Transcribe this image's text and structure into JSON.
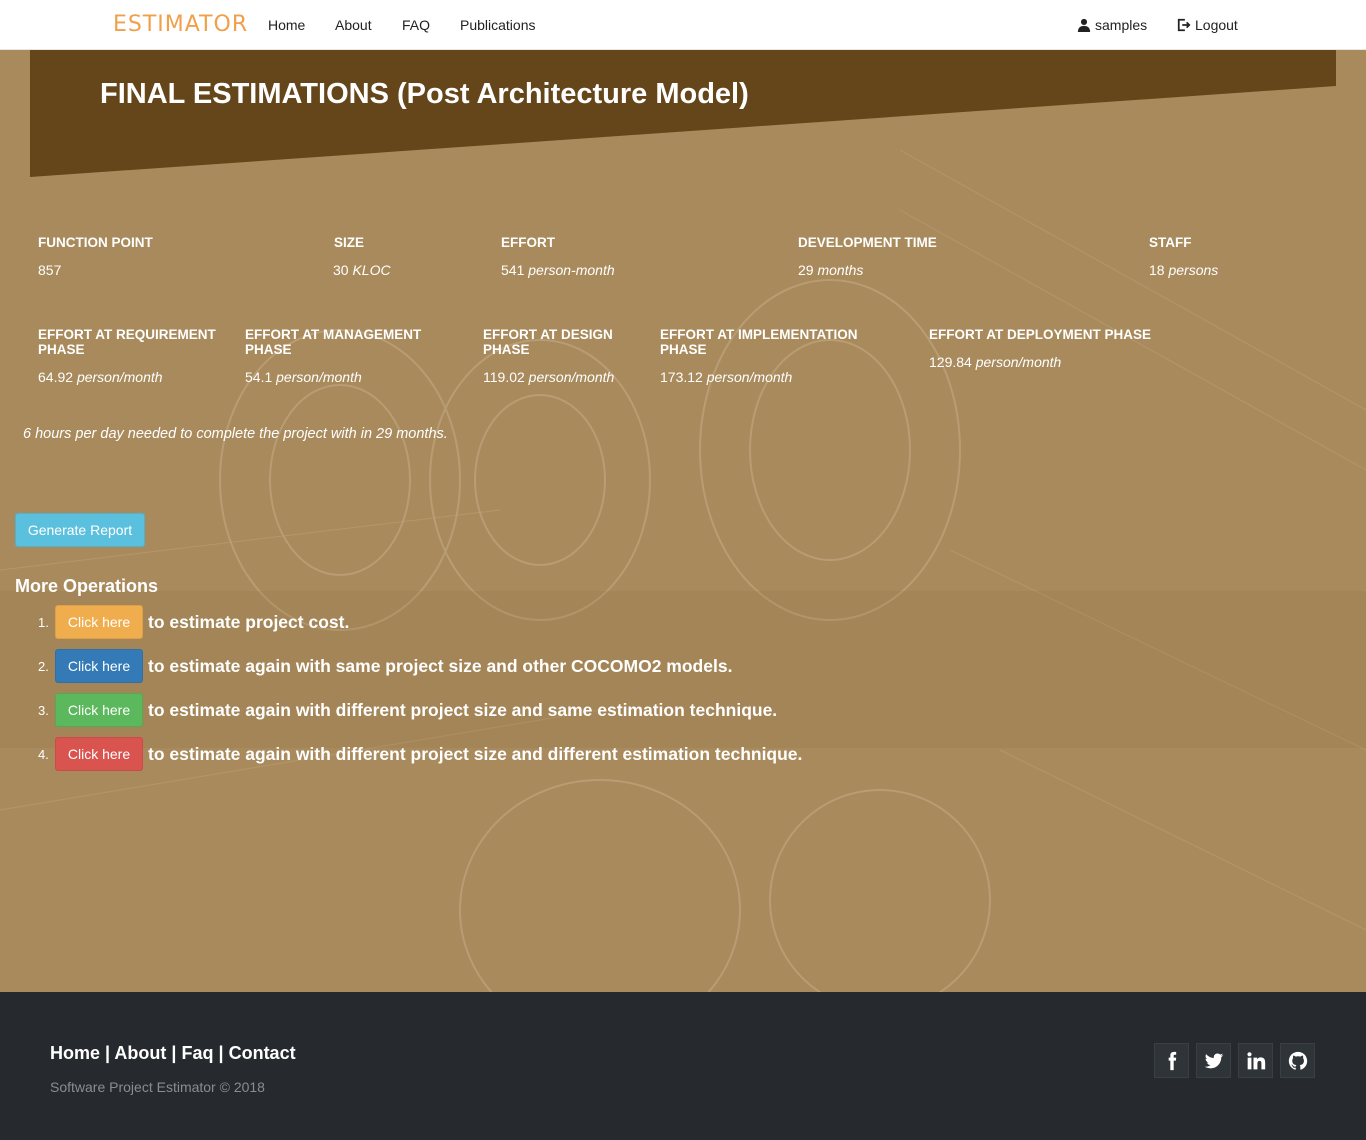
{
  "nav": {
    "logo": "ESTIMATOR",
    "links": [
      "Home",
      "About",
      "FAQ",
      "Publications"
    ],
    "user": "samples",
    "logout": "Logout"
  },
  "banner": {
    "title": "FINAL ESTIMATIONS (Post Architecture Model)"
  },
  "stats_row1": [
    {
      "label": "FUNCTION POINT",
      "value": "857",
      "unit": ""
    },
    {
      "label": "SIZE",
      "value": "30",
      "unit": "KLOC"
    },
    {
      "label": "EFFORT",
      "value": "541",
      "unit": "person-month"
    },
    {
      "label": "DEVELOPMENT TIME",
      "value": "29",
      "unit": "months"
    },
    {
      "label": "STAFF",
      "value": "18",
      "unit": "persons"
    }
  ],
  "stats_row2": [
    {
      "label_line1": "EFFORT AT REQUIREMENT",
      "label_line2": "PHASE",
      "value": "64.92",
      "unit": "person/month"
    },
    {
      "label_line1": "EFFORT AT MANAGEMENT",
      "label_line2": "PHASE",
      "value": "54.1",
      "unit": "person/month"
    },
    {
      "label_line1": "EFFORT AT DESIGN",
      "label_line2": "PHASE",
      "value": "119.02",
      "unit": "person/month"
    },
    {
      "label_line1": "EFFORT AT IMPLEMENTATION",
      "label_line2": "PHASE",
      "value": "173.12",
      "unit": "person/month"
    },
    {
      "label_line1": "EFFORT AT DEPLOYMENT PHASE",
      "label_line2": "",
      "value": "129.84",
      "unit": "person/month"
    }
  ],
  "note": "6 hours per day needed to complete the project with in 29 months.",
  "generate_report": "Generate Report",
  "more_operations": {
    "title": "More Operations",
    "items": [
      {
        "num": "1.",
        "button": "Click here",
        "text": "to estimate project cost."
      },
      {
        "num": "2.",
        "button": "Click here",
        "text": "to estimate again with same project size and other COCOMO2 models."
      },
      {
        "num": "3.",
        "button": "Click here",
        "text": "to estimate again with different project size and same estimation technique."
      },
      {
        "num": "4.",
        "button": "Click here",
        "text": "to estimate again with different project size and different estimation technique."
      }
    ]
  },
  "footer": {
    "links": [
      "Home",
      "About",
      "Faq",
      "Contact"
    ],
    "separator": "|",
    "copyright": "Software Project Estimator © 2018",
    "social": [
      "facebook-icon",
      "twitter-icon",
      "linkedin-icon",
      "github-icon"
    ]
  },
  "colors": {
    "banner": "#65461a",
    "background": "#a98a5c",
    "footer": "#262a2e",
    "logo": "#f0a04b"
  }
}
